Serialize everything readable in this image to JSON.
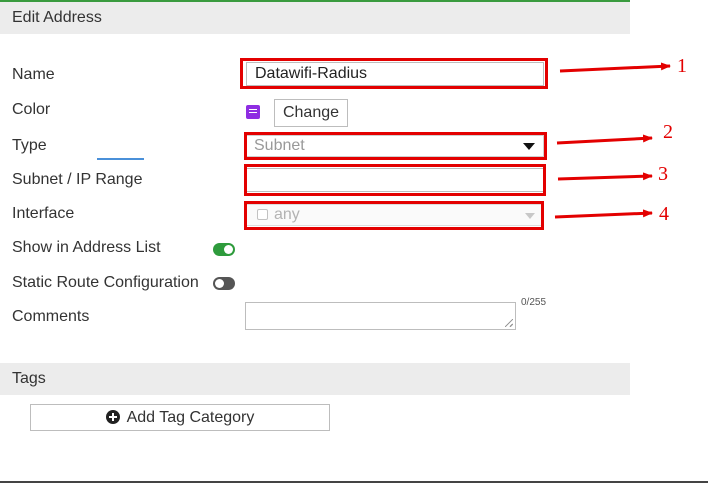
{
  "dialog": {
    "title": "Edit Address"
  },
  "fields": {
    "name": {
      "label": "Name",
      "value": "Datawifi-Radius"
    },
    "color": {
      "label": "Color",
      "change_button": "Change",
      "swatch_color": "#8e2de2"
    },
    "type": {
      "label": "Type",
      "value": "Subnet"
    },
    "subnet": {
      "label": "Subnet / IP Range",
      "value": ""
    },
    "interface": {
      "label": "Interface",
      "value": "any"
    },
    "show_in_address_list": {
      "label": "Show in Address List",
      "enabled": true
    },
    "static_route": {
      "label": "Static Route Configuration",
      "enabled": false
    },
    "comments": {
      "label": "Comments",
      "value": "",
      "counter": "0/255"
    }
  },
  "tags": {
    "title": "Tags",
    "add_button": "Add Tag Category"
  },
  "annotations": {
    "labels": [
      "1",
      "2",
      "3",
      "4"
    ],
    "color": "#e30000"
  },
  "colors": {
    "accent_green": "#2e9b3c",
    "header_bg": "#ececec"
  }
}
